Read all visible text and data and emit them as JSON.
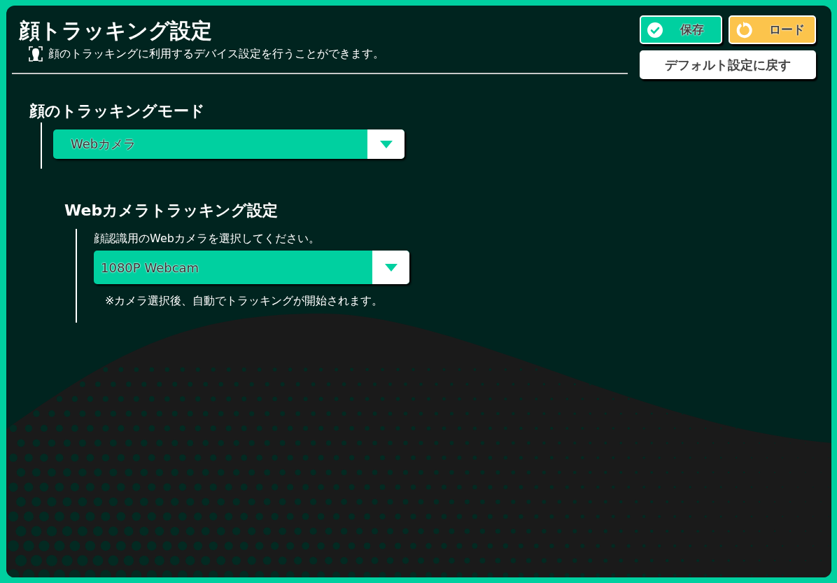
{
  "header": {
    "title": "顔トラッキング設定",
    "description": "顔のトラッキングに利用するデバイス設定を行うことができます。"
  },
  "buttons": [
    {
      "label": "保存",
      "kind": "save"
    },
    {
      "label": "ロード",
      "kind": "load"
    },
    {
      "label": "デフォルト設定に戻す",
      "kind": "reset"
    }
  ],
  "mode": {
    "heading": "顔のトラッキングモード",
    "dropdown": {
      "value": "Webカメラ"
    }
  },
  "webcam": {
    "heading": "Webカメラトラッキング設定",
    "prompt": "顔認識用のWebカメラを選択してください。",
    "dropdown": {
      "value": "1080P Webcam"
    },
    "note": "※カメラ選択後、自動でトラッキングが開始されます。"
  }
}
